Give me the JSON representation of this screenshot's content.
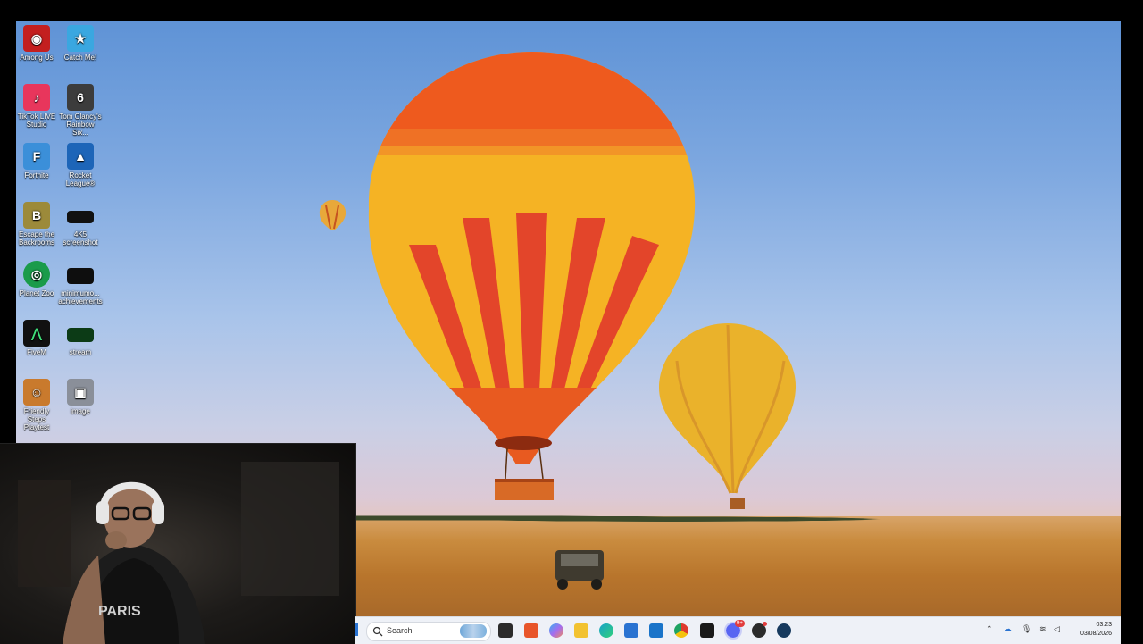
{
  "desktop_icons": [
    {
      "label": "Among Us",
      "icon": "among-us-icon",
      "color": "#c31f1f"
    },
    {
      "label": "Catch Me!",
      "icon": "catch-me-icon",
      "color": "#3aa7e0"
    },
    {
      "label": "TikTok LIVE Studio",
      "icon": "tiktok-live-icon",
      "color": "#e8365c"
    },
    {
      "label": "Tom Clancy's Rainbow Six...",
      "icon": "rainbow-six-icon",
      "color": "#3c3c3c"
    },
    {
      "label": "Fortnite",
      "icon": "fortnite-icon",
      "color": "#3b8fd9"
    },
    {
      "label": "Rocket League®",
      "icon": "rocket-league-icon",
      "color": "#1d65b8"
    },
    {
      "label": "Escape the Backrooms",
      "icon": "escape-backrooms-icon",
      "color": "#9c8a3a"
    },
    {
      "label": "4K5 screenshot",
      "icon": "screenshot-file-icon",
      "color": "#111111"
    },
    {
      "label": "Planet Zoo",
      "icon": "planet-zoo-icon",
      "color": "#1a9b4a"
    },
    {
      "label": "minimumo... achievements",
      "icon": "achievements-file-icon",
      "color": "#0e0e0e"
    },
    {
      "label": "FiveM",
      "icon": "fivem-icon",
      "color": "#111111"
    },
    {
      "label": "stream",
      "icon": "stream-file-icon",
      "color": "#0c3b16"
    },
    {
      "label": "Friendly Steps Playtest",
      "icon": "friendly-steps-icon",
      "color": "#c97a2d"
    },
    {
      "label": "image",
      "icon": "image-file-icon",
      "color": "#8a8f99"
    }
  ],
  "taskbar": {
    "search_placeholder": "Search",
    "pinned": [
      {
        "name": "task-view",
        "color": "#2b2b2b"
      },
      {
        "name": "brave",
        "color": "#e8552a"
      },
      {
        "name": "copilot",
        "color": "#7b6de3"
      },
      {
        "name": "file-explorer",
        "color": "#f2c230"
      },
      {
        "name": "edge",
        "color": "#1aa3c9"
      },
      {
        "name": "store",
        "color": "#2a73d1"
      },
      {
        "name": "outlook",
        "color": "#1a74c9"
      },
      {
        "name": "chrome",
        "color": "#de3a2e"
      },
      {
        "name": "fivem",
        "color": "#1a1a1a"
      },
      {
        "name": "discord",
        "color": "#5865f2"
      },
      {
        "name": "obs",
        "color": "#2b2b2b"
      },
      {
        "name": "steam",
        "color": "#173a5e"
      }
    ],
    "discord_badge": "9+",
    "clock_time": "03:23",
    "clock_date": "03/08/2026"
  }
}
